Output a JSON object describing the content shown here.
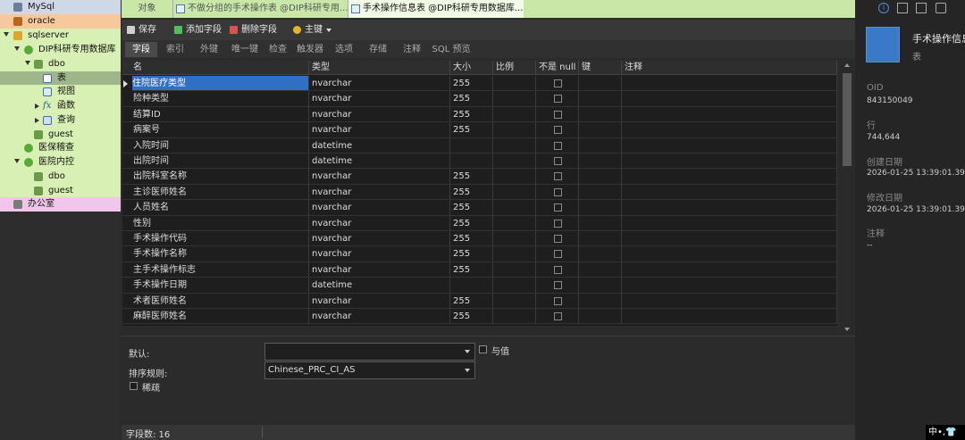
{
  "navigator": {
    "items": [
      {
        "label": "MySql",
        "icon": "mysql-icon"
      },
      {
        "label": "oracle",
        "icon": "oracle-icon"
      },
      {
        "label": "sqlserver",
        "icon": "sqlserver-icon"
      },
      {
        "label": "DIP科研专用数据库",
        "icon": "database-icon"
      },
      {
        "label": "dbo",
        "icon": "schema-icon"
      },
      {
        "label": "表",
        "icon": "table-icon"
      },
      {
        "label": "视图",
        "icon": "view-icon"
      },
      {
        "label": "函数",
        "icon": "function-icon"
      },
      {
        "label": "查询",
        "icon": "query-icon"
      },
      {
        "label": "guest",
        "icon": "schema-icon"
      },
      {
        "label": "医保稽查",
        "icon": "database-icon"
      },
      {
        "label": "医院内控",
        "icon": "database-icon"
      },
      {
        "label": "dbo",
        "icon": "schema-icon"
      },
      {
        "label": "guest",
        "icon": "schema-icon"
      },
      {
        "label": "办公室",
        "icon": "connection-icon"
      }
    ]
  },
  "tabs": {
    "objects": "对象",
    "tab1": "不做分组的手术操作表 @DIP科研专用...",
    "tab2": "手术操作信息表 @DIP科研专用数据库...."
  },
  "toolbar": {
    "save": "保存",
    "add_field": "添加字段",
    "delete_field": "删除字段",
    "primary_key": "主键"
  },
  "subtabs": [
    "字段",
    "索引",
    "外键",
    "唯一键",
    "检查",
    "触发器",
    "选项",
    "存储",
    "注释",
    "SQL 预览"
  ],
  "grid": {
    "headers": [
      "名",
      "类型",
      "大小",
      "比例",
      "不是 null",
      "键",
      "注释"
    ],
    "rows": [
      {
        "name": "住院医疗类型",
        "type": "nvarchar",
        "size": "255"
      },
      {
        "name": "险种类型",
        "type": "nvarchar",
        "size": "255"
      },
      {
        "name": "结算ID",
        "type": "nvarchar",
        "size": "255"
      },
      {
        "name": "病案号",
        "type": "nvarchar",
        "size": "255"
      },
      {
        "name": "入院时间",
        "type": "datetime",
        "size": ""
      },
      {
        "name": "出院时间",
        "type": "datetime",
        "size": ""
      },
      {
        "name": "出院科室名称",
        "type": "nvarchar",
        "size": "255"
      },
      {
        "name": "主诊医师姓名",
        "type": "nvarchar",
        "size": "255"
      },
      {
        "name": "人员姓名",
        "type": "nvarchar",
        "size": "255"
      },
      {
        "name": "性别",
        "type": "nvarchar",
        "size": "255"
      },
      {
        "name": "手术操作代码",
        "type": "nvarchar",
        "size": "255"
      },
      {
        "name": "手术操作名称",
        "type": "nvarchar",
        "size": "255"
      },
      {
        "name": "主手术操作标志",
        "type": "nvarchar",
        "size": "255"
      },
      {
        "name": "手术操作日期",
        "type": "datetime",
        "size": ""
      },
      {
        "name": "术者医师姓名",
        "type": "nvarchar",
        "size": "255"
      },
      {
        "name": "麻醉医师姓名",
        "type": "nvarchar",
        "size": "255"
      }
    ]
  },
  "props": {
    "default_label": "默认:",
    "default_value": "",
    "with_value_label": "与值",
    "collation_label": "排序规则:",
    "collation_value": "Chinese_PRC_CI_AS",
    "sparse_label": "稀疏"
  },
  "status": {
    "field_count": "字段数: 16"
  },
  "info": {
    "title": "手术操作信息表",
    "subtitle": "表",
    "oid_label": "OID",
    "oid_value": "843150049",
    "rows_label": "行",
    "rows_value": "744,644",
    "created_label": "创建日期",
    "created_value": "2026-01-25 13:39:01.39",
    "modified_label": "修改日期",
    "modified_value": "2026-01-25 13:39:01.39",
    "comment_label": "注释",
    "comment_value": "--"
  },
  "ime": "中•,👕"
}
